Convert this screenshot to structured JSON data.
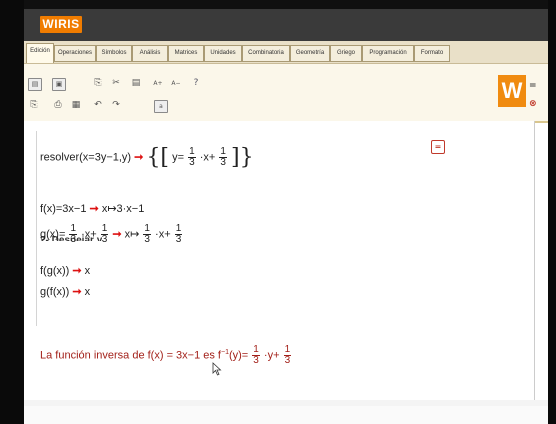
{
  "app": {
    "logo": "WIRIS",
    "brand_color": "#f07c00"
  },
  "tabs": [
    "Edición",
    "Operaciones",
    "Símbolos",
    "Análisis",
    "Matrices",
    "Unidades",
    "Combinatoria",
    "Geometría",
    "Griego",
    "Programación",
    "Formato"
  ],
  "toolbar": {
    "w_logo": "W",
    "side_icon_top": "=",
    "side_icon_bottom": "⊗",
    "icons": [
      "save-icon",
      "print-icon",
      "undo-icon",
      "redo-icon",
      "copy-icon",
      "cut-icon",
      "paste-icon",
      "help-icon"
    ]
  },
  "doc": {
    "cutoff_heading": "2- Despejar y",
    "line1": {
      "cmd": "resolver(x=3y−1,y)",
      "arrow": "➞",
      "res_prefix": "y=",
      "f1_num": "1",
      "f1_den": "3",
      "mid": "·x+",
      "f2_num": "1",
      "f2_den": "3"
    },
    "line2": {
      "lhs": "f(x)=3x−1",
      "arrow": "➞",
      "rhs": "x↦3·x−1"
    },
    "line3": {
      "lhs_prefix": "g(x)=",
      "f1_num": "1",
      "f1_den": "3",
      "lhs_mid": "·x+",
      "f2_num": "1",
      "f2_den": "3",
      "arrow": "➞",
      "rhs_prefix": "x↦",
      "rhs_mid": "·x+"
    },
    "line4": {
      "lhs": "f(g(x))",
      "arrow": "➞",
      "rhs": "x"
    },
    "line5": {
      "lhs": "g(f(x))",
      "arrow": "➞",
      "rhs": "x"
    },
    "result": {
      "prefix": "La función inversa de f(x) = 3x−1 es f",
      "sup": "−1",
      "suffix": "(y)=",
      "f1_num": "1",
      "f1_den": "3",
      "mid": "·y+",
      "f2_num": "1",
      "f2_den": "3"
    },
    "calc_button": "="
  }
}
